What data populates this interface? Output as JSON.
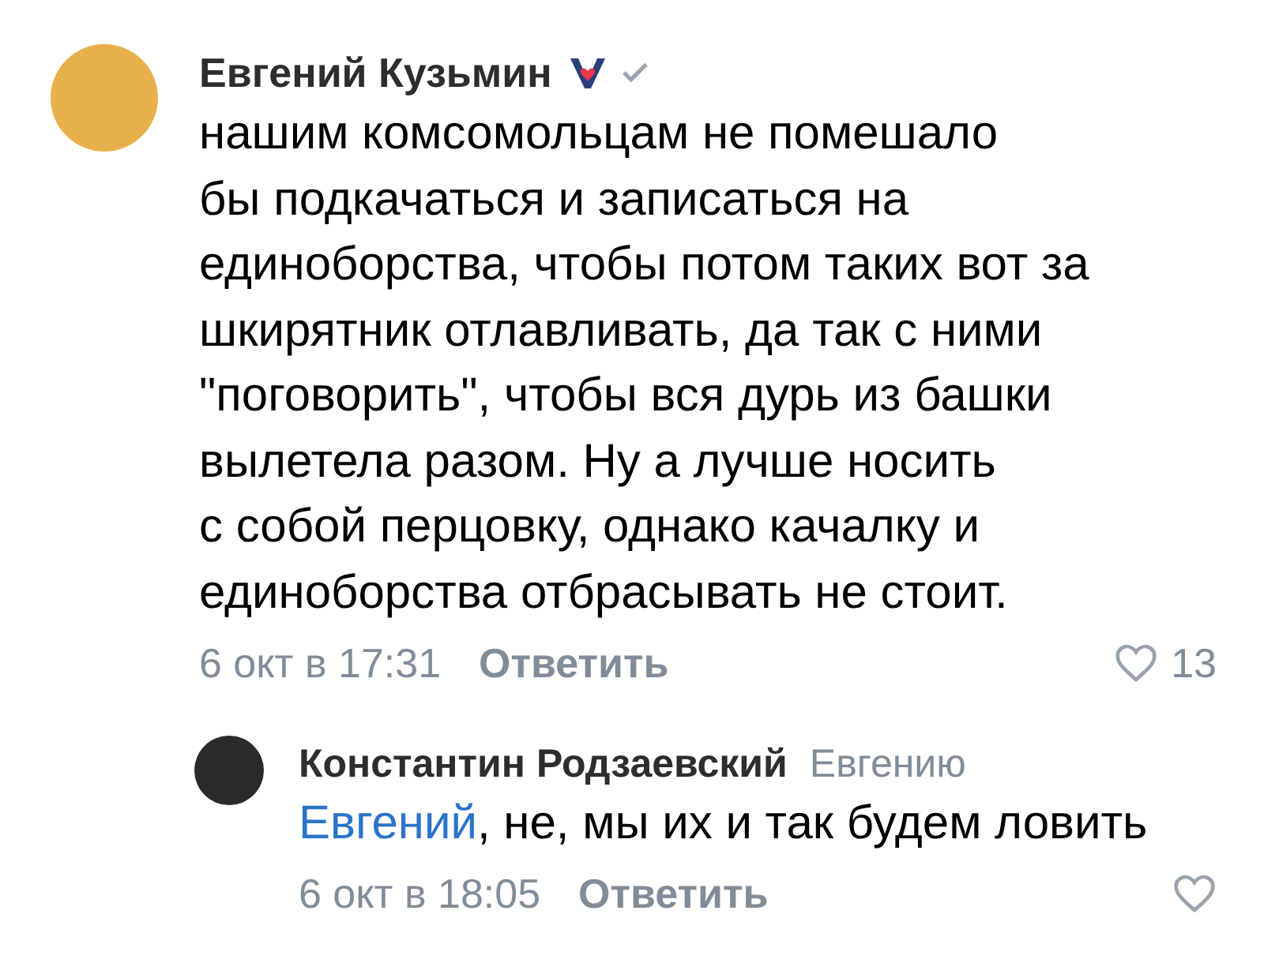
{
  "comments": [
    {
      "author": "Евгений Кузьмин",
      "badge": true,
      "verified": true,
      "text": "нашим комсомольцам не помешало\nбы подкачаться и записаться на\nединоборства, чтобы потом таких вот за\nшкирятник отлавливать, да так с ними\n\"поговорить\", чтобы вся дурь из башки\nвылетела разом. Ну а лучше носить\nс собой перцовку, однако качалку и\nединоборства отбрасывать не стоит.",
      "date": "6 окт в 17:31",
      "reply_action": "Ответить",
      "liked": false,
      "likes": "13",
      "replies": [
        {
          "author": "Константин Родзаевский",
          "reply_to": "Евгению",
          "mention": "Евгений",
          "text": ", не, мы их и так будем ловить",
          "date": "6 окт в 18:05",
          "reply_action": "Ответить",
          "liked": false
        }
      ]
    }
  ]
}
